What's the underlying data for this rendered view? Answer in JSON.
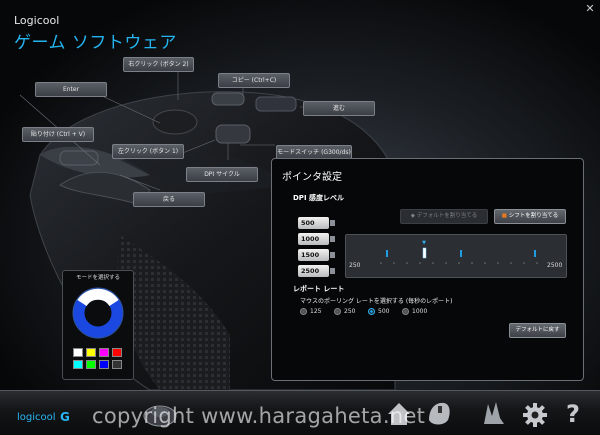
{
  "header": {
    "brand": "Logicool",
    "title": "ゲーム ソフトウェア",
    "close_icon": "close-icon"
  },
  "callouts": {
    "right_click": "右クリック (ボタン 2)",
    "copy": "コピー (Ctrl+C)",
    "enter": "Enter",
    "forward": "進む",
    "paste": "貼り付け (Ctrl + V)",
    "left_click": "左クリック (ボタン 1)",
    "mode_switch": "モードスイッチ (G300/ds)",
    "dpi_cycle": "DPI サイクル",
    "back": "戻る"
  },
  "mode_panel": {
    "title": "モードを選択する",
    "swatch_colors": [
      "#ffffff",
      "#ffff00",
      "#ff00ff",
      "#ff0000",
      "#00ffff",
      "#00ff00",
      "#0000ff",
      "#333333"
    ]
  },
  "pointer_settings": {
    "title": "ポインタ設定",
    "dpi_heading": "DPI 感度レベル",
    "assign_default_label": "デフォルトを割り当てる",
    "assign_shift_label": "シフトを割り当てる",
    "dpi_levels": [
      "500",
      "1000",
      "1500",
      "2500"
    ],
    "slider_min": "250",
    "slider_max": "2500",
    "report_rate_heading": "レポート レート",
    "report_rate_sub": "マウスのポーリング レートを選択する (毎秒のレポート)",
    "report_rates": [
      "125",
      "250",
      "500",
      "1000"
    ],
    "selected_rate": "500",
    "restore_default_label": "デフォルトに戻す"
  },
  "bottom_bar": {
    "logo_text": "logicool",
    "logo_icon": "logicool-g-icon",
    "watermark": "copyright www.haragaheta.net",
    "icons": [
      "mouse-device-icon",
      "home-icon",
      "customize-buttons-icon",
      "pointer-settings-icon",
      "gear-icon",
      "help-icon"
    ]
  },
  "colors": {
    "accent": "#24b5f0",
    "shift_button_accent": "#e87a1e"
  }
}
